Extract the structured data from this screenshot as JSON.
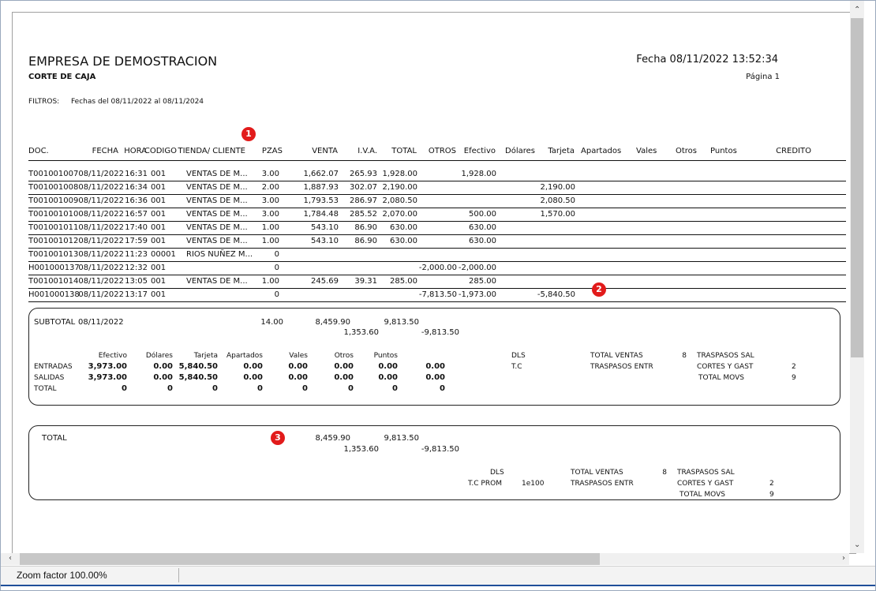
{
  "report": {
    "company": "EMPRESA DE DEMOSTRACION",
    "subtitle": "CORTE DE CAJA",
    "fecha": "Fecha 08/11/2022 13:52:34",
    "pagina": "Página 1",
    "filtros_label": "FILTROS:",
    "filtros_value": "Fechas del 08/11/2022 al 08/11/2024"
  },
  "columns": [
    "DOC.",
    "FECHA",
    "HORA",
    "CODIGO",
    "TIENDA/ CLIENTE",
    "PZAS",
    "VENTA",
    "I.V.A.",
    "TOTAL",
    "OTROS",
    "Efectivo",
    "Dólares",
    "Tarjeta",
    "Apartados",
    "Vales",
    "Otros",
    "Puntos",
    "CREDITO"
  ],
  "rows": [
    {
      "doc": "T001001007",
      "fecha": "08/11/2022",
      "hora": "16:31",
      "codigo": "001",
      "cliente": "VENTAS DE M...",
      "pzas": "3.00",
      "venta": "1,662.07",
      "iva": "265.93",
      "total": "1,928.00",
      "otros": "",
      "efectivo": "1,928.00",
      "tarjeta": ""
    },
    {
      "doc": "T001001008",
      "fecha": "08/11/2022",
      "hora": "16:34",
      "codigo": "001",
      "cliente": "VENTAS DE M...",
      "pzas": "2.00",
      "venta": "1,887.93",
      "iva": "302.07",
      "total": "2,190.00",
      "otros": "",
      "efectivo": "",
      "tarjeta": "2,190.00"
    },
    {
      "doc": "T001001009",
      "fecha": "08/11/2022",
      "hora": "16:36",
      "codigo": "001",
      "cliente": "VENTAS DE M...",
      "pzas": "3.00",
      "venta": "1,793.53",
      "iva": "286.97",
      "total": "2,080.50",
      "otros": "",
      "efectivo": "",
      "tarjeta": "2,080.50"
    },
    {
      "doc": "T001001010",
      "fecha": "08/11/2022",
      "hora": "16:57",
      "codigo": "001",
      "cliente": "VENTAS DE M...",
      "pzas": "3.00",
      "venta": "1,784.48",
      "iva": "285.52",
      "total": "2,070.00",
      "otros": "",
      "efectivo": "500.00",
      "tarjeta": "1,570.00"
    },
    {
      "doc": "T001001011",
      "fecha": "08/11/2022",
      "hora": "17:40",
      "codigo": "001",
      "cliente": "VENTAS DE M...",
      "pzas": "1.00",
      "venta": "543.10",
      "iva": "86.90",
      "total": "630.00",
      "otros": "",
      "efectivo": "630.00",
      "tarjeta": ""
    },
    {
      "doc": "T001001012",
      "fecha": "08/11/2022",
      "hora": "17:59",
      "codigo": "001",
      "cliente": "VENTAS DE M...",
      "pzas": "1.00",
      "venta": "543.10",
      "iva": "86.90",
      "total": "630.00",
      "otros": "",
      "efectivo": "630.00",
      "tarjeta": ""
    },
    {
      "doc": "T001001013",
      "fecha": "08/11/2022",
      "hora": "11:23",
      "codigo": "00001",
      "cliente": "RIOS NUÑEZ M...",
      "pzas": "0",
      "venta": "",
      "iva": "",
      "total": "",
      "otros": "",
      "efectivo": "",
      "tarjeta": ""
    },
    {
      "doc": "H001000137",
      "fecha": "08/11/2022",
      "hora": "12:32",
      "codigo": "001",
      "cliente": "",
      "pzas": "0",
      "venta": "",
      "iva": "",
      "total": "",
      "otros": "-2,000.00",
      "efectivo": "-2,000.00",
      "tarjeta": ""
    },
    {
      "doc": "T001001014",
      "fecha": "08/11/2022",
      "hora": "13:05",
      "codigo": "001",
      "cliente": "VENTAS DE M...",
      "pzas": "1.00",
      "venta": "245.69",
      "iva": "39.31",
      "total": "285.00",
      "otros": "",
      "efectivo": "285.00",
      "tarjeta": ""
    },
    {
      "doc": "H001000138",
      "fecha": "08/11/2022",
      "hora": "13:17",
      "codigo": "001",
      "cliente": "",
      "pzas": "0",
      "venta": "",
      "iva": "",
      "total": "",
      "otros": "-7,813.50",
      "efectivo": "-1,973.00",
      "tarjeta": "-5,840.50"
    }
  ],
  "subtotal": {
    "label": "SUBTOTAL",
    "date": "08/11/2022",
    "pzas": "14.00",
    "venta": "8,459.90",
    "total": "9,813.50",
    "iva": "1,353.60",
    "otros": "-9,813.50",
    "pay_headers": [
      "Efectivo",
      "Dólares",
      "Tarjeta",
      "Apartados",
      "Vales",
      "Otros",
      "Puntos"
    ],
    "lines": [
      {
        "label": "ENTRADAS",
        "values": [
          "3,973.00",
          "0.00",
          "5,840.50",
          "0.00",
          "0.00",
          "0.00",
          "0.00",
          "0.00"
        ]
      },
      {
        "label": "SALIDAS",
        "values": [
          "3,973.00",
          "0.00",
          "5,840.50",
          "0.00",
          "0.00",
          "0.00",
          "0.00",
          "0.00"
        ]
      },
      {
        "label": "TOTAL",
        "values": [
          "0",
          "0",
          "0",
          "0",
          "0",
          "0",
          "0",
          "0"
        ]
      }
    ],
    "dls": "DLS",
    "tc": "T.C",
    "total_ventas_label": "TOTAL VENTAS",
    "total_ventas": "8",
    "traspasos_entr": "TRASPASOS ENTR",
    "traspasos_sal": "TRASPASOS SAL",
    "cortes_gast": "CORTES Y GAST",
    "cortes_gast_val": "2",
    "total_movs": "TOTAL MOVS",
    "total_movs_val": "9"
  },
  "total": {
    "label": "TOTAL",
    "venta": "8,459.90",
    "total": "9,813.50",
    "iva": "1,353.60",
    "otros": "-9,813.50",
    "dls": "DLS",
    "tc_prom": "T.C PROM",
    "tc_prom_val": "1e100",
    "total_ventas_label": "TOTAL VENTAS",
    "total_ventas": "8",
    "traspasos_entr": "TRASPASOS ENTR",
    "traspasos_sal": "TRASPASOS SAL",
    "cortes_gast": "CORTES Y GAST",
    "cortes_gast_val": "2",
    "total_movs": "TOTAL MOVS",
    "total_movs_val": "9"
  },
  "badges": [
    "1",
    "2",
    "3"
  ],
  "status": {
    "zoom": "Zoom factor 100.00%"
  },
  "colors": {
    "badge": "#e21b1b",
    "accent": "#1f4e99"
  }
}
